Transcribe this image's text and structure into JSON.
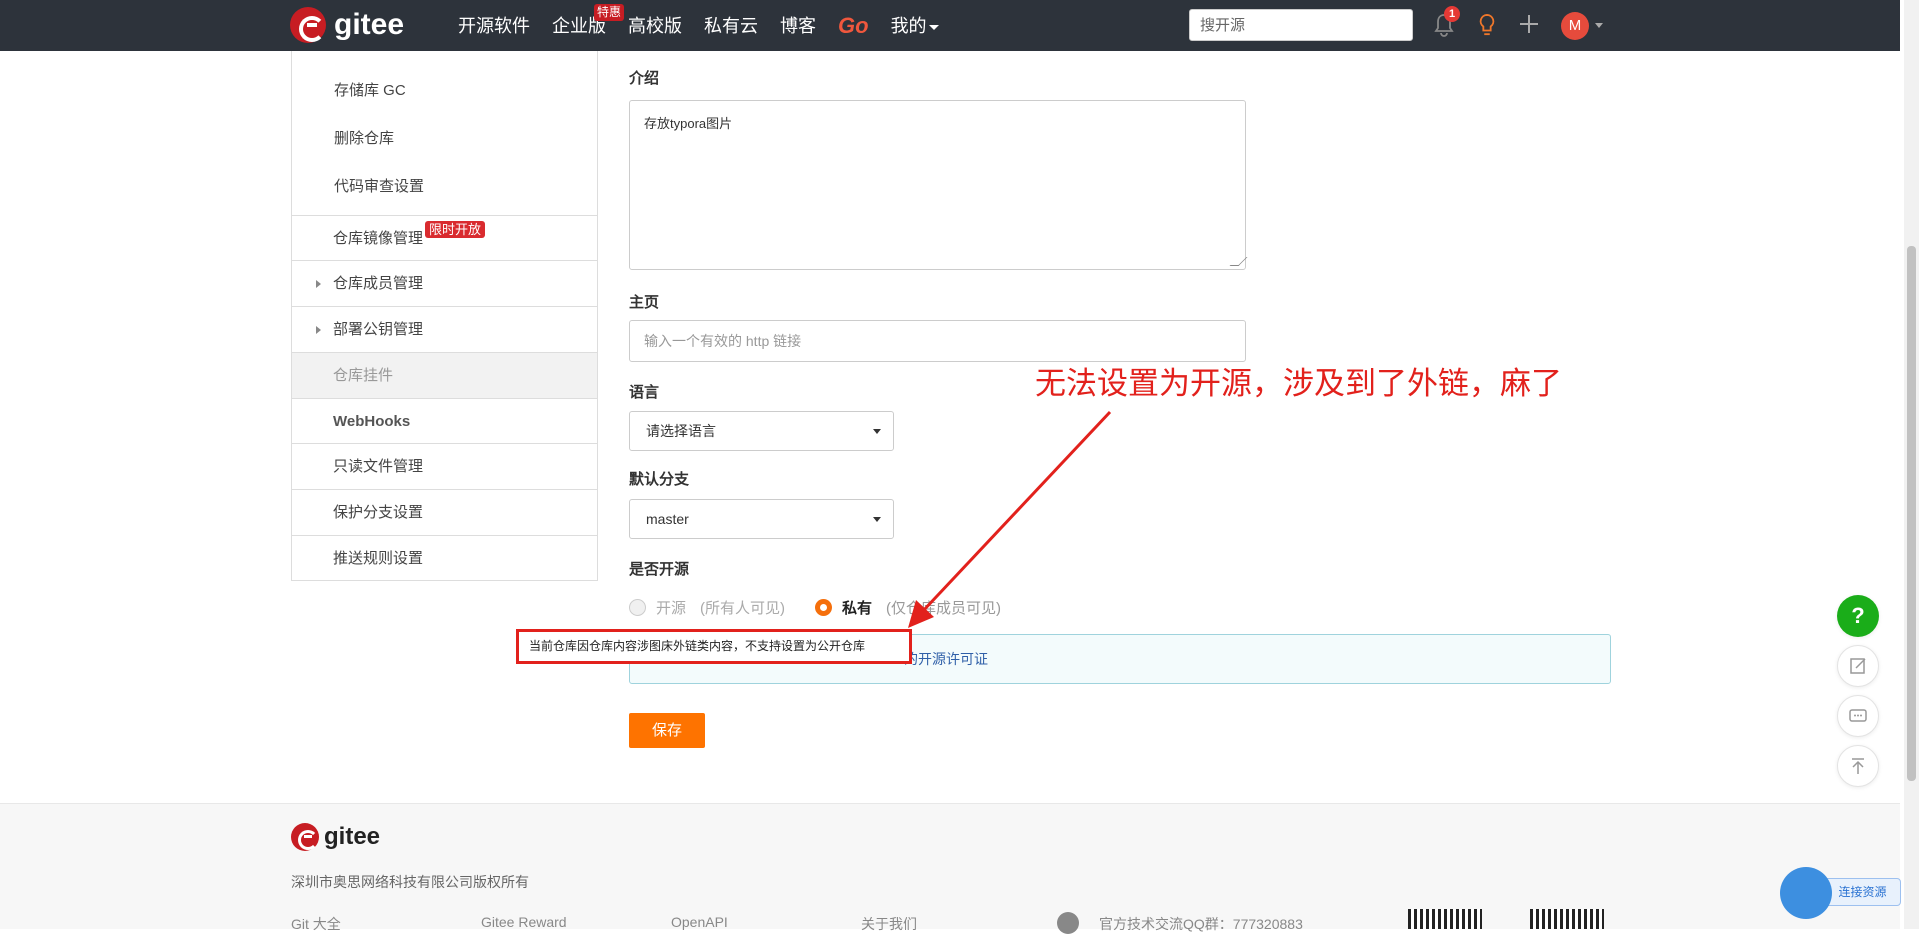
{
  "topbar": {
    "brand": "gitee",
    "nav": [
      "开源软件",
      "企业版",
      "高校版",
      "私有云",
      "博客",
      "Go",
      "我的"
    ],
    "nav_hot_badge": "特惠",
    "search_placeholder": "搜开源",
    "notification_count": "1",
    "avatar_initial": "M"
  },
  "sidebar": {
    "items": [
      {
        "label": "存储库 GC"
      },
      {
        "label": "删除仓库"
      },
      {
        "label": "代码审查设置"
      },
      {
        "label": "仓库镜像管理",
        "badge": "限时开放"
      },
      {
        "label": "仓库成员管理"
      },
      {
        "label": "部署公钥管理"
      },
      {
        "label": "仓库挂件"
      },
      {
        "label": "WebHooks"
      },
      {
        "label": "只读文件管理"
      },
      {
        "label": "保护分支设置"
      },
      {
        "label": "推送规则设置"
      }
    ]
  },
  "form": {
    "intro_label": "介绍",
    "intro_value": "存放typora图片",
    "homepage_label": "主页",
    "homepage_placeholder": "输入一个有效的 http 链接",
    "language_label": "语言",
    "language_value": "请选择语言",
    "branch_label": "默认分支",
    "branch_value": "master",
    "opensource_label": "是否开源",
    "radio_open": "开源",
    "radio_open_desc": "(所有人可见)",
    "radio_private": "私有",
    "radio_private_desc": "(仅仓库成员可见)",
    "info_link": "的开源许可证",
    "tooltip": "当前仓库因仓库内容涉图床外链类内容，不支持设置为公开仓库",
    "save_label": "保存"
  },
  "annotation": "无法设置为开源，涉及到了外链，麻了",
  "footer": {
    "brand": "gitee",
    "copyright": "深圳市奥思网络科技有限公司版权所有",
    "links": [
      "Git 大全",
      "Gitee Reward",
      "OpenAPI",
      "关于我们"
    ],
    "qq_group": "官方技术交流QQ群：777320883"
  },
  "float_widget": {
    "help": "?",
    "connect_label": "连接资源"
  },
  "colors": {
    "topbar": "#2d333b",
    "brand_red": "#c71d23",
    "accent_orange": "#fe7300",
    "annotation_red": "#e2211c",
    "help_green": "#1aad19"
  }
}
